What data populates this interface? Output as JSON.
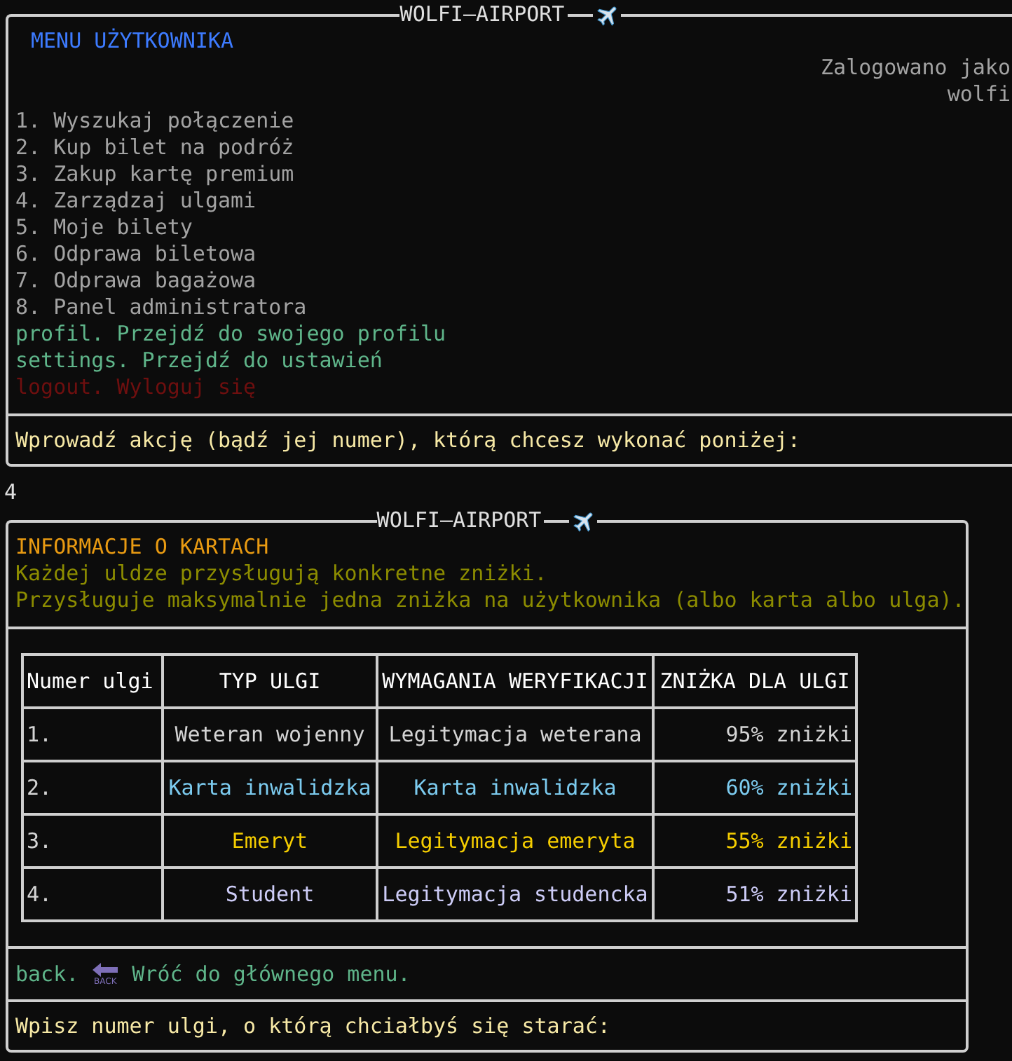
{
  "main_menu": {
    "title": "WOLFI—AIRPORT",
    "heading": "MENU UŻYTKOWNIKA",
    "login_label": "Zalogowano jako",
    "username": "wolfi",
    "items": [
      {
        "label": "1. Wyszukaj połączenie",
        "color": "#a3a3a3"
      },
      {
        "label": "2. Kup bilet na podróż",
        "color": "#a3a3a3"
      },
      {
        "label": "3. Zakup kartę premium",
        "color": "#a3a3a3"
      },
      {
        "label": "4. Zarządzaj ulgami",
        "color": "#a3a3a3"
      },
      {
        "label": "5. Moje bilety",
        "color": "#a3a3a3"
      },
      {
        "label": "6. Odprawa biletowa",
        "color": "#a3a3a3"
      },
      {
        "label": "7. Odprawa bagażowa",
        "color": "#a3a3a3"
      },
      {
        "label": "8. Panel administratora",
        "color": "#a3a3a3"
      },
      {
        "label": "profil. Przejdź do swojego profilu",
        "color": "#5fb58a"
      },
      {
        "label": "settings. Przejdź do ustawień",
        "color": "#5fb58a"
      },
      {
        "label": "logout. Wyloguj się",
        "color": "#6e0f0f"
      }
    ],
    "prompt": "Wprowadź akcję (bądź jej numer), którą chcesz wykonać poniżej:"
  },
  "typed_input": "4",
  "cards_panel": {
    "title": "WOLFI—AIRPORT",
    "heading": "INFORMACJE O KARTACH",
    "info_lines": [
      "Każdej uldze przysługują konkretne zniżki.",
      "Przysługuje maksymalnie jedna zniżka na użytkownika (albo karta albo ulga)."
    ],
    "table": {
      "columns": [
        "Numer ulgi",
        "TYP ULGI",
        "WYMAGANIA WERYFIKACJI",
        "ZNIŻKA DLA ULGI"
      ],
      "rows": [
        {
          "cells": [
            "1.",
            "Weteran wojenny",
            "Legitymacja weterana",
            "95% zniżki"
          ],
          "color": "#d4d4d4"
        },
        {
          "cells": [
            "2.",
            "Karta inwalidzka",
            "Karta inwalidzka",
            "60% zniżki"
          ],
          "color": "#7ccbef"
        },
        {
          "cells": [
            "3.",
            "Emeryt",
            "Legitymacja emeryta",
            "55% zniżki"
          ],
          "color": "#f5cd00"
        },
        {
          "cells": [
            "4.",
            "Student",
            "Legitymacja studencka",
            "51% zniżki"
          ],
          "color": "#cdccf7"
        }
      ]
    },
    "back": {
      "command": "back.",
      "icon_label": "BACK",
      "text": "Wróć do głównego menu."
    },
    "prompt": "Wpisz numer ulgi, o którą chciałbyś się starać:"
  }
}
